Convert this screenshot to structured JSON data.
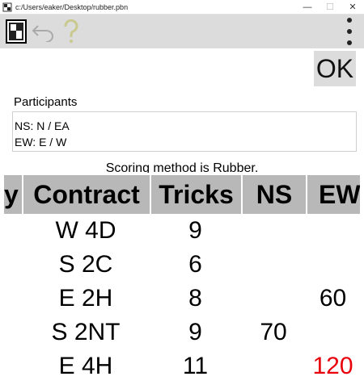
{
  "window": {
    "title": "c:/Users/eaker/Desktop/rubber.pbn",
    "minimize": "—",
    "maximize": "☐",
    "close": "✕"
  },
  "toolbar": {
    "scorecard_icon": "scorecard-icon",
    "undo_icon": "undo-icon",
    "help_icon": "help-icon",
    "menu_icon": "more-vert-icon"
  },
  "ok_label": "OK",
  "participants": {
    "label": "Participants",
    "ns": "NS:  N / EA",
    "ew": "EW: E / W"
  },
  "scoring_text": "Scoring method is Rubber.",
  "table": {
    "headers": {
      "partial": "y",
      "contract": "Contract",
      "tricks": "Tricks",
      "ns": "NS",
      "ew": "EW"
    },
    "rows": [
      {
        "contract": "W 4D",
        "tricks": "9",
        "ns": "",
        "ew": ""
      },
      {
        "contract": "S 2C",
        "tricks": "6",
        "ns": "",
        "ew": ""
      },
      {
        "contract": "E 2H",
        "tricks": "8",
        "ns": "",
        "ew": "60"
      },
      {
        "contract": "S 2NT",
        "tricks": "9",
        "ns": "70",
        "ew": ""
      },
      {
        "contract": "E 4H",
        "tricks": "11",
        "ns": "",
        "ew": "120"
      }
    ]
  },
  "colors": {
    "toolbar_bg": "#dcdcdc",
    "header_bg": "#b8b8b8",
    "highlight_red": "#e8000b"
  }
}
